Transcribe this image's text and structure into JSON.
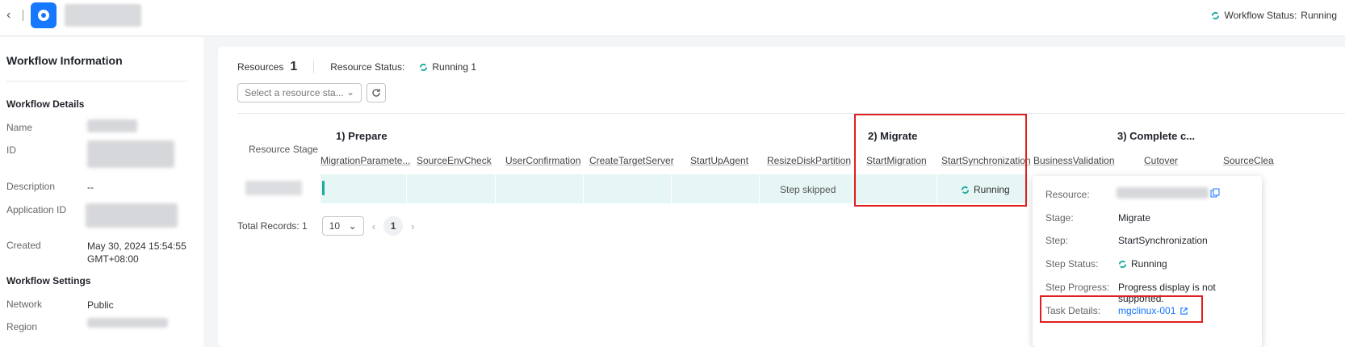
{
  "topbar": {
    "workflow_status_label": "Workflow Status:",
    "workflow_status_value": "Running"
  },
  "sidebar": {
    "title": "Workflow Information",
    "details_heading": "Workflow Details",
    "name_label": "Name",
    "id_label": "ID",
    "description_label": "Description",
    "description_value": "--",
    "application_id_label": "Application ID",
    "created_label": "Created",
    "created_value_line1": "May 30, 2024 15:54:55",
    "created_value_line2": "GMT+08:00",
    "settings_heading": "Workflow Settings",
    "network_label": "Network",
    "network_value": "Public",
    "region_label": "Region"
  },
  "main": {
    "resources_label": "Resources",
    "resources_count": "1",
    "resource_status_label": "Resource Status:",
    "resource_status_value": "Running 1",
    "stage_select_placeholder": "Select a resource sta...",
    "stages": [
      "1)  Prepare",
      "2)  Migrate",
      "3)  Complete c..."
    ],
    "resource_stage_header": "Resource  Stage",
    "columns": [
      "MigrationParamete...",
      "SourceEnvCheck",
      "UserConfirmation",
      "CreateTargetServer",
      "StartUpAgent",
      "ResizeDiskPartition",
      "StartMigration",
      "StartSynchronization",
      "BusinessValidation",
      "Cutover",
      "SourceClea"
    ],
    "row": {
      "resize_status": "Step skipped",
      "sync_status": "Running"
    },
    "total_records": "Total Records: 1",
    "page_size": "10",
    "current_page": "1"
  },
  "popover": {
    "resource_label": "Resource:",
    "stage_label": "Stage:",
    "stage_value": "Migrate",
    "step_label": "Step:",
    "step_value": "StartSynchronization",
    "step_status_label": "Step Status:",
    "step_status_value": "Running",
    "step_progress_label": "Step Progress:",
    "step_progress_value": "Progress display is not supported.",
    "task_details_label": "Task Details:",
    "task_details_value": "mgclinux-001"
  },
  "colors": {
    "accent": "#1476ff",
    "running": "#19a9a0",
    "highlight": "#e02020"
  }
}
